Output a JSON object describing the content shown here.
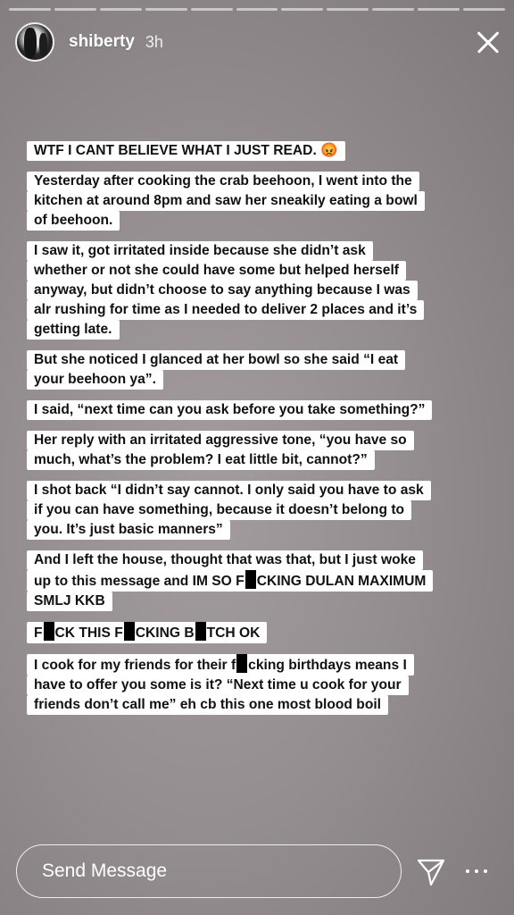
{
  "header": {
    "username": "shiberty",
    "time": "3h",
    "progress_segments": 11,
    "active_segment": 10
  },
  "story": {
    "blocks": [
      {
        "lines": [
          [
            "WTF I CANT BELIEVE WHAT I JUST READ. 😡"
          ]
        ]
      },
      {
        "lines": [
          [
            "Yesterday after cooking the crab beehoon, I went into the"
          ],
          [
            "kitchen at around 8pm and saw her sneakily eating a bowl"
          ],
          [
            "of beehoon."
          ]
        ]
      },
      {
        "lines": [
          [
            "I saw it, got irritated inside because she didn’t ask"
          ],
          [
            "whether or not she could have some but helped herself"
          ],
          [
            "anyway, but didn’t choose to say anything because I was"
          ],
          [
            "alr rushing for time as I needed to deliver 2 places and it’s"
          ],
          [
            "getting late."
          ]
        ]
      },
      {
        "lines": [
          [
            "But she noticed I glanced at her bowl so she said “I eat"
          ],
          [
            "your beehoon ya”."
          ]
        ]
      },
      {
        "lines": [
          [
            "I said, “next time can you ask before you take something?”"
          ]
        ]
      },
      {
        "lines": [
          [
            "Her reply with an irritated aggressive tone, “you have so"
          ],
          [
            "much, what’s the problem? I eat little bit, cannot?”"
          ]
        ]
      },
      {
        "lines": [
          [
            "I shot back “I didn’t say cannot. I only said you have to ask"
          ],
          [
            "if you can have something, because it doesn’t belong to"
          ],
          [
            "you. It’s just basic manners”"
          ]
        ]
      },
      {
        "lines": [
          [
            "And I left the house, thought that was that, but I just woke"
          ],
          [
            "up to this message and IM SO F",
            "CKING DULAN MAXIMUM"
          ],
          [
            "SMLJ KKB"
          ]
        ]
      },
      {
        "lines": [
          [
            "F",
            "CK THIS F",
            "CKING B",
            "TCH OK"
          ]
        ]
      },
      {
        "lines": [
          [
            "I cook for my friends for their f",
            "cking birthdays means I"
          ],
          [
            "have to offer you some is it? “Next time u cook for your"
          ],
          [
            "friends don’t call me” eh cb this one most blood boil"
          ]
        ]
      }
    ]
  },
  "footer": {
    "send_placeholder": "Send Message",
    "send_icon": "paper-plane-icon",
    "more_icon": "more-dots-icon"
  }
}
